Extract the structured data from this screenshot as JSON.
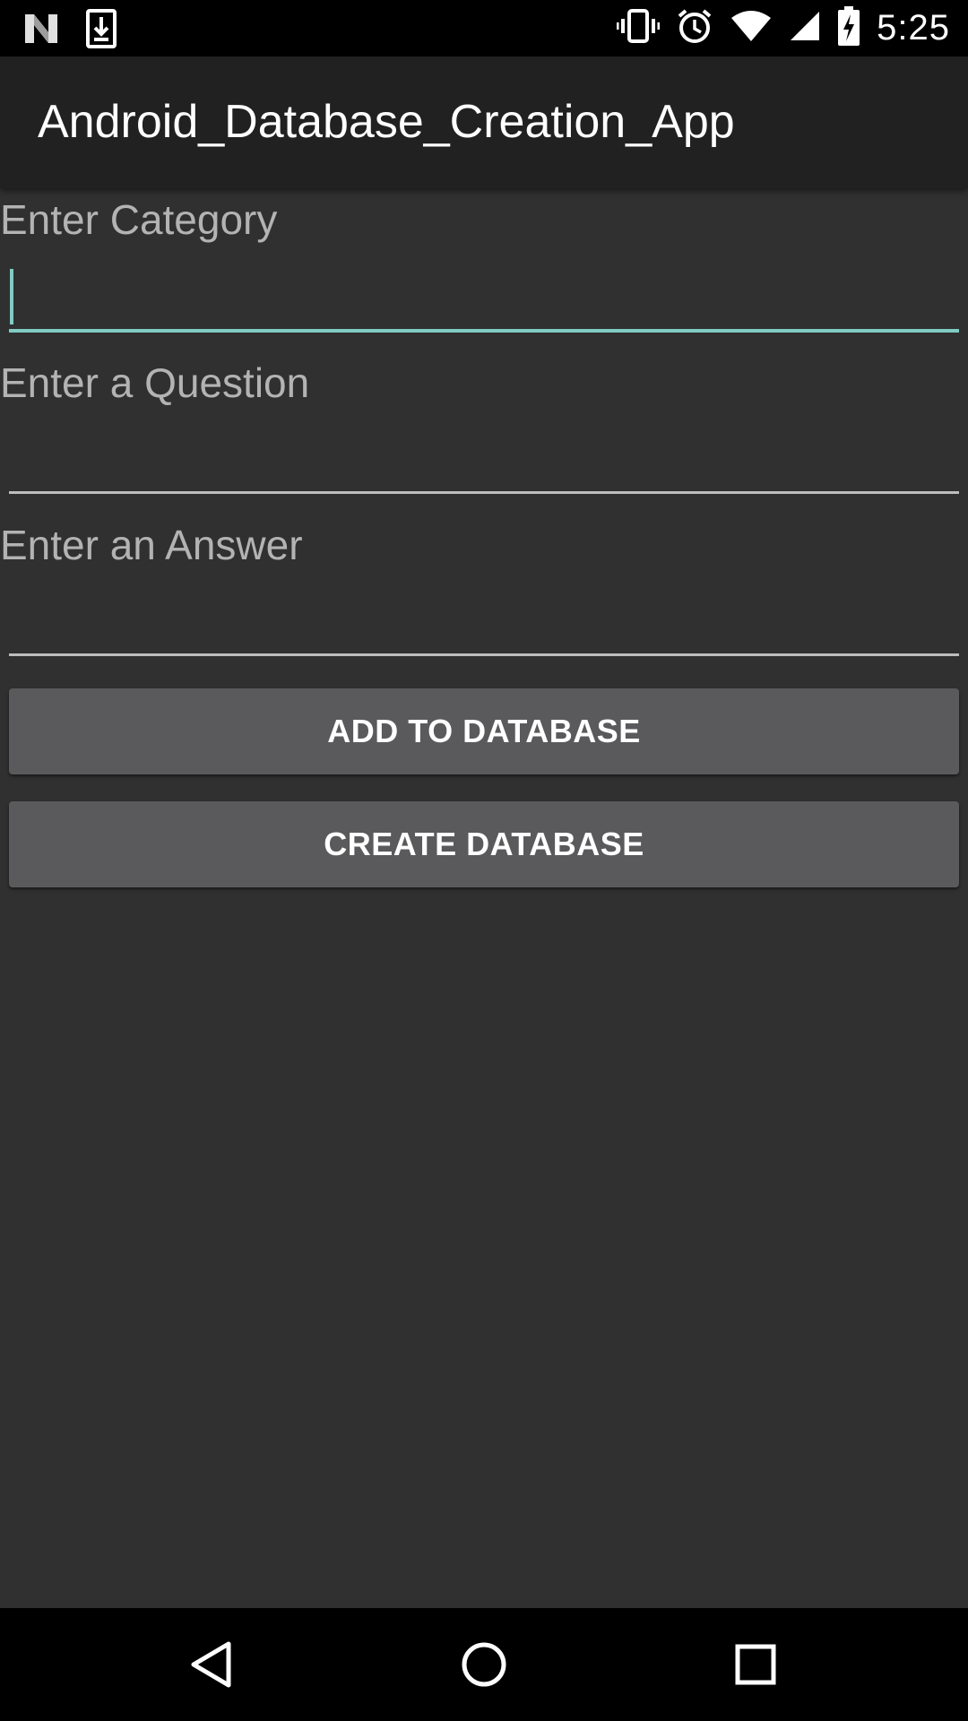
{
  "status_bar": {
    "time": "5:25",
    "icons": [
      "notification-n-icon",
      "download-icon",
      "vibrate-icon",
      "alarm-icon",
      "wifi-icon",
      "cell-signal-icon",
      "battery-charging-icon"
    ]
  },
  "app_bar": {
    "title": "Android_Database_Creation_App"
  },
  "form": {
    "category_label": "Enter Category",
    "category_value": "",
    "question_label": "Enter a Question",
    "question_value": "",
    "answer_label": "Enter an Answer",
    "answer_value": ""
  },
  "buttons": {
    "add_label": "ADD TO DATABASE",
    "create_label": "CREATE DATABASE"
  },
  "nav_bar": {
    "icons": [
      "back-icon",
      "home-icon",
      "recents-icon"
    ]
  },
  "colors": {
    "background": "#303030",
    "app_bar": "#212121",
    "accent": "#80cbc4",
    "button": "#5a5a5c"
  }
}
